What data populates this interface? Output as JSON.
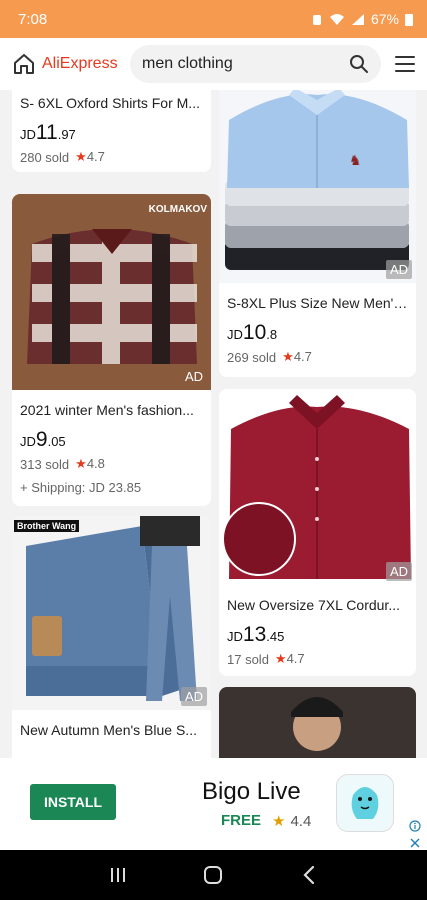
{
  "status": {
    "time": "7:08",
    "battery": "67%"
  },
  "header": {
    "brand": "AliExpress",
    "search_value": "men clothing"
  },
  "products": [
    {
      "title": "S- 6XL Oxford Shirts For M...",
      "currency": "JD",
      "price_int": "11",
      "price_dec": ".97",
      "sold": "280 sold",
      "rating": "4.7"
    },
    {
      "title": "S-8XL Plus Size New Men's ...",
      "currency": "JD",
      "price_int": "10",
      "price_dec": ".8",
      "sold": "269 sold",
      "rating": "4.7",
      "ad": "AD"
    },
    {
      "title": "2021 winter Men's fashion...",
      "currency": "JD",
      "price_int": "9",
      "price_dec": ".05",
      "sold": "313 sold",
      "rating": "4.8",
      "shipping": "+ Shipping: JD 23.85",
      "ad": "AD",
      "brand_overlay": "KOLMAKOV"
    },
    {
      "title": "New Oversize 7XL Cordur...",
      "currency": "JD",
      "price_int": "13",
      "price_dec": ".45",
      "sold": "17 sold",
      "rating": "4.7",
      "ad": "AD"
    },
    {
      "title": "New Autumn Men's Blue S...",
      "ad": "AD",
      "brand_overlay": "Brother Wang"
    }
  ],
  "ad_banner": {
    "install": "INSTALL",
    "app_name": "Bigo Live",
    "free": "FREE",
    "rating": "4.4"
  },
  "colors": {
    "status_bar": "#f69a50",
    "brand": "#e8391d",
    "install": "#1a8754"
  },
  "icons": {
    "home": "home-icon",
    "search": "search-icon",
    "menu": "menu-icon"
  }
}
